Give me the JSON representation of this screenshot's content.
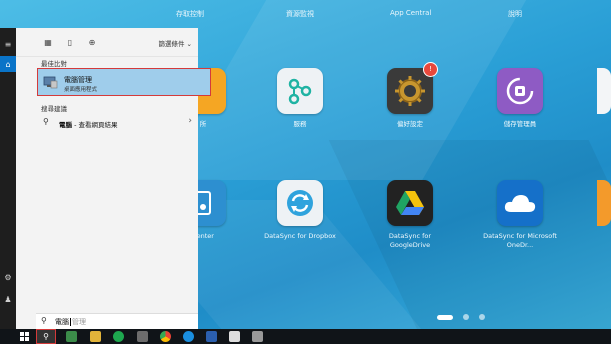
{
  "desktop": {
    "top_labels": [
      "存取控制",
      "資源監視",
      "App Central",
      "說明"
    ],
    "apps_row1": [
      {
        "name": "",
        "color": "#f5a623"
      },
      {
        "name": "服務",
        "color": "#e9eef2",
        "icon": "share-network-icon"
      },
      {
        "name": "偏好設定",
        "color": "#3a3a3a",
        "icon": "gear-icon",
        "badge": "!"
      },
      {
        "name": "儲存管理員",
        "color": "#8e5bc4",
        "icon": "storage-manager-icon"
      }
    ],
    "apps_row2": [
      {
        "name": "Center",
        "color": "#2d8fd0",
        "icon": "device-icon"
      },
      {
        "name": "DataSync for Dropbox",
        "color": "#e9eef2",
        "icon": "sync-icon"
      },
      {
        "name": "DataSync for GoogleDrive",
        "color": "#222222",
        "icon": "google-drive-icon"
      },
      {
        "name": "DataSync for Microsoft OneDr...",
        "color": "#1570c9",
        "icon": "onedrive-icon"
      }
    ]
  },
  "start_menu": {
    "filters_label": "篩選條件",
    "best_match_header": "最佳比對",
    "best_match": {
      "title": "電腦管理",
      "subtitle": "桌面應用程式"
    },
    "search_suggestions_header": "搜尋建議",
    "suggestion": {
      "term": "電腦",
      "suffix": " - 查看網頁結果"
    },
    "search_query": "電腦",
    "search_ghost": "管理"
  },
  "colors": {
    "accent": "#0a74c8",
    "highlight": "#9fcdeb",
    "focus_border": "#d43a3a"
  }
}
